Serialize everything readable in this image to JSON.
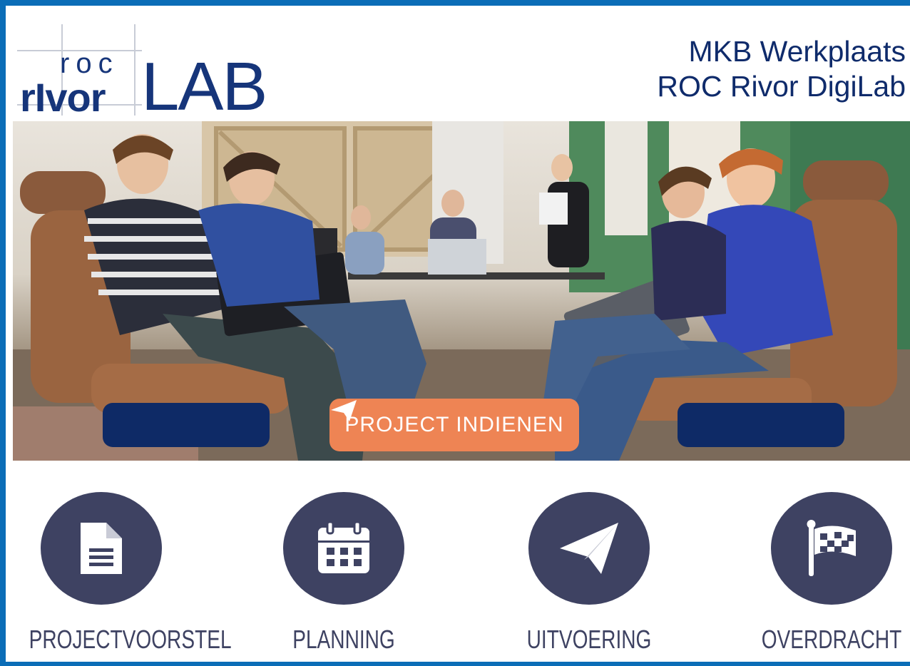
{
  "header": {
    "logo": {
      "roc": "roc",
      "rivor": "rIvor",
      "lab": "LAB"
    },
    "title_line1": "MKB Werkplaats",
    "title_line2": "ROC Rivor DigiLab"
  },
  "hero": {
    "image": "photo of students working on laptops in lounge chairs",
    "buttons": {
      "left_label": "",
      "submit_label": "PROJECT INDIENEN",
      "submit_icon": "paper-plane-icon",
      "right_label": ""
    }
  },
  "steps": [
    {
      "label": "PROJECTVOORSTEL",
      "icon": "document-icon"
    },
    {
      "label": "PLANNING",
      "icon": "calendar-icon"
    },
    {
      "label": "UITVOERING",
      "icon": "paper-plane-icon"
    },
    {
      "label": "OVERDRACHT",
      "icon": "checkered-flag-icon"
    }
  ],
  "colors": {
    "frame": "#0b6db7",
    "brand": "#16357a",
    "dark_button": "#0e2a66",
    "submit_button": "#ee8454",
    "step_circle": "#3e4262"
  }
}
